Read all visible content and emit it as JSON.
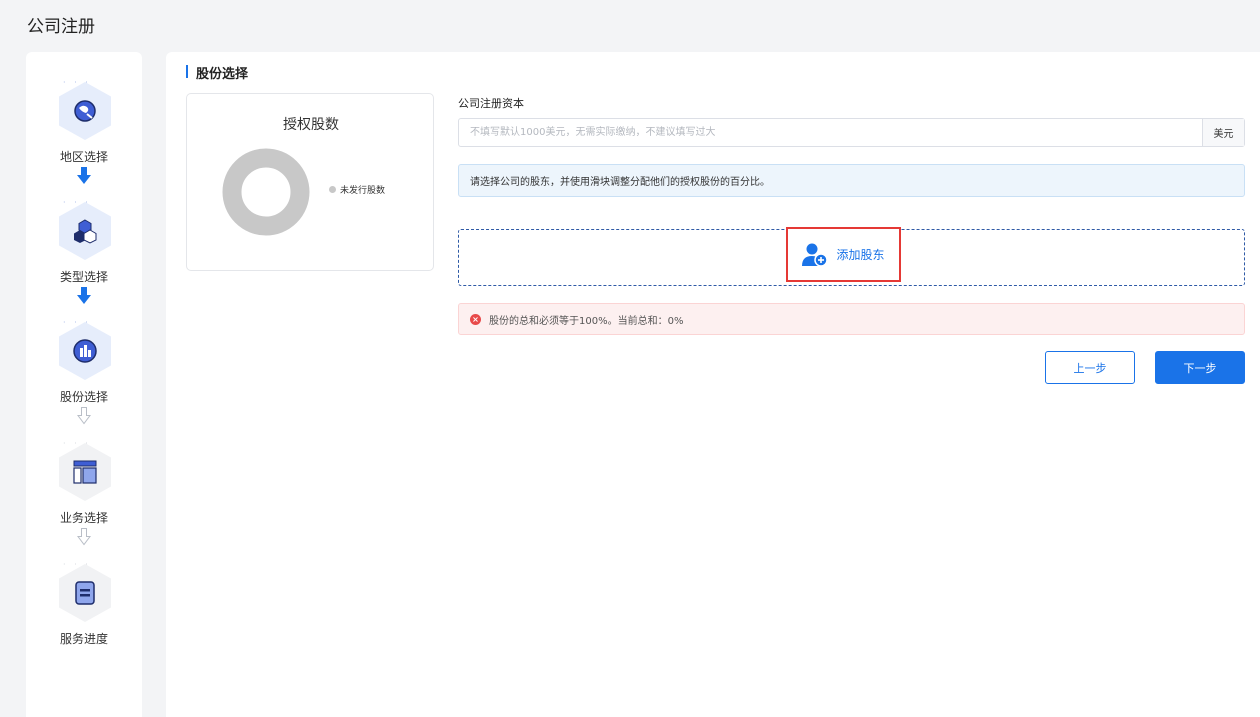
{
  "page": {
    "title": "公司注册"
  },
  "steps": [
    {
      "label": "地区选择",
      "state": "done",
      "icon": "region-icon"
    },
    {
      "label": "类型选择",
      "state": "done",
      "icon": "type-icon"
    },
    {
      "label": "股份选择",
      "state": "current",
      "icon": "shares-icon"
    },
    {
      "label": "业务选择",
      "state": "pending",
      "icon": "business-icon"
    },
    {
      "label": "服务进度",
      "state": "pending",
      "icon": "progress-icon"
    }
  ],
  "section": {
    "title": "股份选择"
  },
  "chart": {
    "title": "授权股数",
    "legend_label": "未发行股数"
  },
  "chart_data": {
    "type": "pie",
    "title": "授权股数",
    "categories": [
      "未发行股数"
    ],
    "values": [
      100
    ],
    "colors": [
      "#c8c8c8"
    ]
  },
  "capital": {
    "label": "公司注册资本",
    "placeholder": "不填写默认1000美元，无需实际缴纳，不建议填写过大",
    "value": "",
    "suffix": "美元"
  },
  "info": {
    "text": "请选择公司的股东，并使用滑块调整分配他们的授权股份的百分比。"
  },
  "add_shareholder": {
    "label": "添加股东"
  },
  "error": {
    "text": "股份的总和必须等于100%。当前总和：0%"
  },
  "buttons": {
    "prev": "上一步",
    "next": "下一步"
  },
  "colors": {
    "primary": "#1a73e8",
    "error": "#e84a4a",
    "highlight": "#e53935"
  }
}
